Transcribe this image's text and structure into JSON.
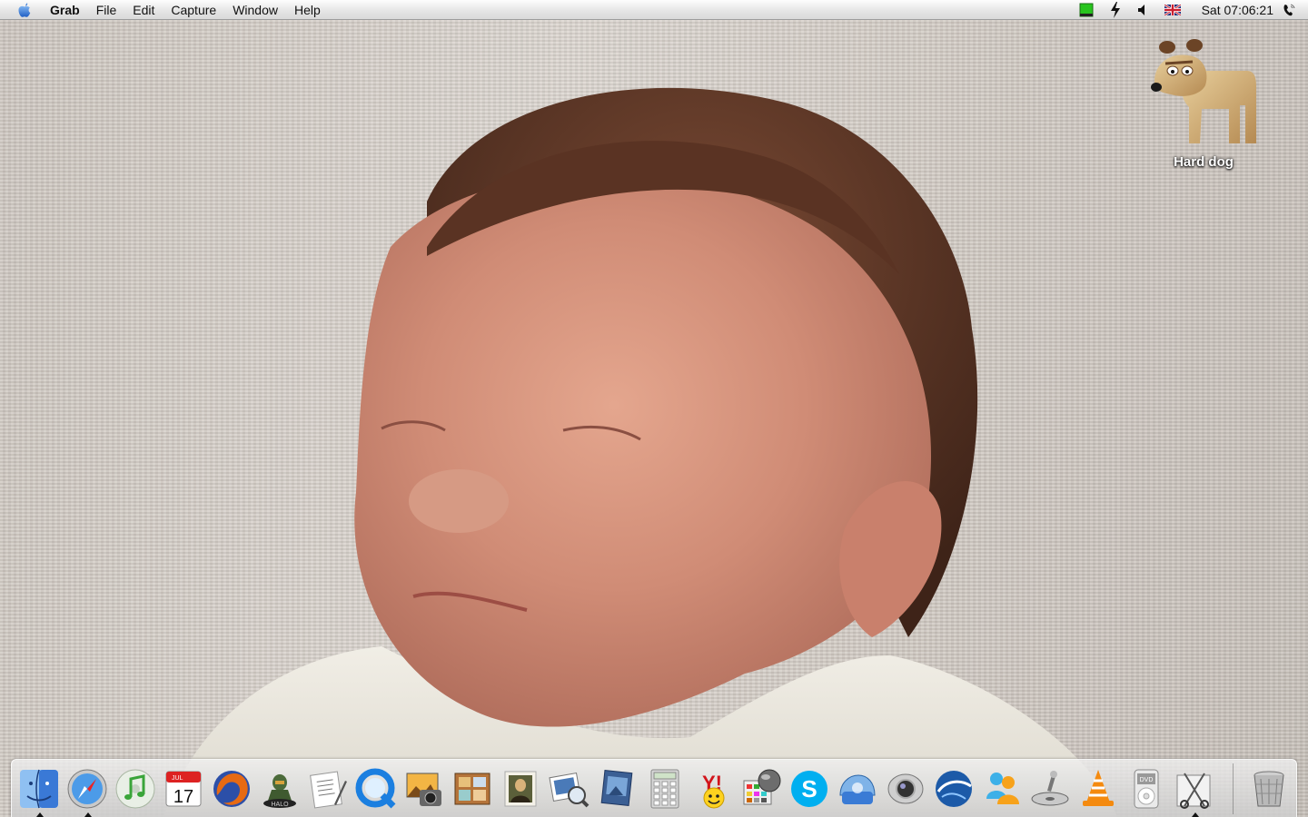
{
  "menubar": {
    "app_name": "Grab",
    "menus": [
      "File",
      "Edit",
      "Capture",
      "Window",
      "Help"
    ],
    "clock": "Sat 07:06:21"
  },
  "status_icons": [
    "battery-icon",
    "sync-icon",
    "volume-icon",
    "uk-flag-icon",
    "phone-icon"
  ],
  "desktop": {
    "icons": [
      {
        "label": "Hard dog",
        "icon": "gromit-drive-icon"
      }
    ],
    "wallpaper": "baby-photo"
  },
  "dock": {
    "apps": [
      {
        "name": "finder-icon",
        "running": true
      },
      {
        "name": "safari-icon",
        "running": true
      },
      {
        "name": "itunes-icon",
        "running": false
      },
      {
        "name": "ical-icon",
        "running": false,
        "month": "JUL",
        "day": "17"
      },
      {
        "name": "firefox-icon",
        "running": false
      },
      {
        "name": "halo-icon",
        "running": false,
        "text": "HALO"
      },
      {
        "name": "textedit-icon",
        "running": false
      },
      {
        "name": "quicktime-icon",
        "running": false
      },
      {
        "name": "iphoto-icon",
        "running": false
      },
      {
        "name": "photo-booth-icon",
        "running": false
      },
      {
        "name": "mona-lisa-icon",
        "running": false
      },
      {
        "name": "preview-icon",
        "running": false
      },
      {
        "name": "image-capture-icon",
        "running": false
      },
      {
        "name": "calculator-icon",
        "running": false
      },
      {
        "name": "yahoo-messenger-icon",
        "running": false,
        "text": "Y!"
      },
      {
        "name": "palette-icon",
        "running": false
      },
      {
        "name": "skype-icon",
        "running": false
      },
      {
        "name": "network-icon",
        "running": false
      },
      {
        "name": "camera-icon",
        "running": false
      },
      {
        "name": "google-earth-icon",
        "running": false
      },
      {
        "name": "msn-messenger-icon",
        "running": false
      },
      {
        "name": "dvd-player-icon",
        "running": false
      },
      {
        "name": "vlc-icon",
        "running": false
      },
      {
        "name": "ipod-icon",
        "running": false,
        "text": "DVD"
      },
      {
        "name": "grab-icon",
        "running": true
      }
    ],
    "trash": {
      "name": "trash-icon"
    }
  },
  "colors": {
    "menubar_top": "#fdfdfd",
    "menubar_bottom": "#d9d9d9",
    "battery_green": "#27c41e",
    "finder_blue": "#3a79d6",
    "firefox_orange": "#e66a14",
    "skype_blue": "#00aff0",
    "vlc_orange": "#f48a0f"
  }
}
